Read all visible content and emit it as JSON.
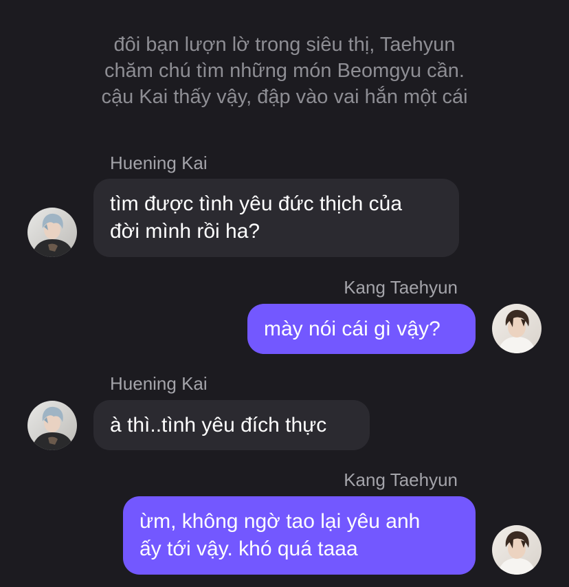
{
  "narration": {
    "line1": "đôi bạn lượn lờ trong siêu thị, Taehyun",
    "line2": "chăm chú tìm những món Beomgyu cần.",
    "line3": "cậu Kai thấy vậy, đập vào vai hắn một cái"
  },
  "messages": [
    {
      "sender": "Huening Kai",
      "direction": "incoming",
      "line1": "tìm được tình yêu đức thịch của",
      "line2": "đời mình rồi ha?"
    },
    {
      "sender": "Kang Taehyun",
      "direction": "outgoing",
      "line1": "mày nói cái gì vậy?"
    },
    {
      "sender": "Huening Kai",
      "direction": "incoming",
      "line1": "à thì..tình yêu đích thực"
    },
    {
      "sender": "Kang Taehyun",
      "direction": "outgoing",
      "line1": "ừm, không ngờ tao lại yêu anh",
      "line2": "ấy tới vậy. khó quá taaa"
    }
  ],
  "colors": {
    "background": "#1c1b20",
    "incoming_bubble": "#2b2a30",
    "outgoing_bubble": "#7358ff",
    "narration_text": "#8e8e94",
    "sender_text": "#a4a4aa"
  },
  "icons": {
    "kai_avatar": "kai-avatar-photo",
    "taehyun_avatar": "taehyun-avatar-photo"
  }
}
